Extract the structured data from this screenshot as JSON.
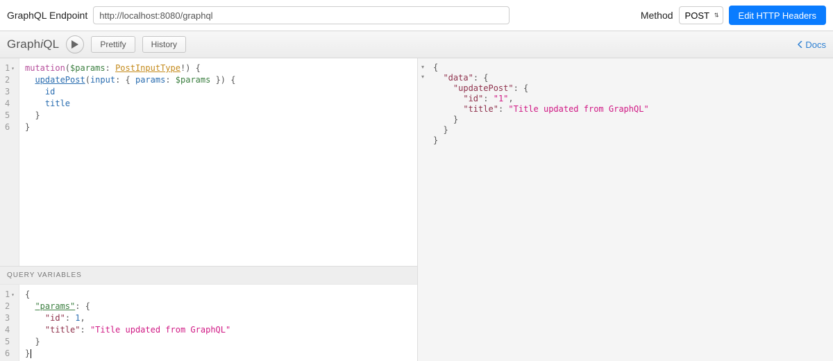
{
  "topbar": {
    "endpoint_label": "GraphQL Endpoint",
    "endpoint_value": "http://localhost:8080/graphql",
    "method_label": "Method",
    "method_value": "POST",
    "edit_headers_label": "Edit HTTP Headers"
  },
  "toolbar": {
    "logo_plain1": "Graph",
    "logo_italic": "i",
    "logo_plain2": "QL",
    "prettify_label": "Prettify",
    "history_label": "History",
    "docs_label": "Docs"
  },
  "query": {
    "lines": [
      {
        "n": "1",
        "fold": true
      },
      {
        "n": "2",
        "fold": false
      },
      {
        "n": "3",
        "fold": false
      },
      {
        "n": "4",
        "fold": false
      },
      {
        "n": "5",
        "fold": false
      },
      {
        "n": "6",
        "fold": false
      }
    ],
    "tokens": {
      "mutation": "mutation",
      "params_var": "$params",
      "type_name": "PostInputType",
      "bang": "!",
      "updatePost": "updatePost",
      "input_kw": "input",
      "params_kw": "params",
      "id_field": "id",
      "title_field": "title"
    }
  },
  "variables": {
    "header": "Query Variables",
    "lines": [
      {
        "n": "1",
        "fold": true
      },
      {
        "n": "2",
        "fold": false
      },
      {
        "n": "3",
        "fold": false
      },
      {
        "n": "4",
        "fold": false
      },
      {
        "n": "5",
        "fold": false
      },
      {
        "n": "6",
        "fold": false
      }
    ],
    "json": {
      "params_key": "\"params\"",
      "id_key": "\"id\"",
      "id_val": "1",
      "title_key": "\"title\"",
      "title_val": "\"Title updated from GraphQL\""
    }
  },
  "result": {
    "data_key": "\"data\"",
    "updatePost_key": "\"updatePost\"",
    "id_key": "\"id\"",
    "id_val": "\"1\"",
    "title_key": "\"title\"",
    "title_val": "\"Title updated from GraphQL\""
  }
}
